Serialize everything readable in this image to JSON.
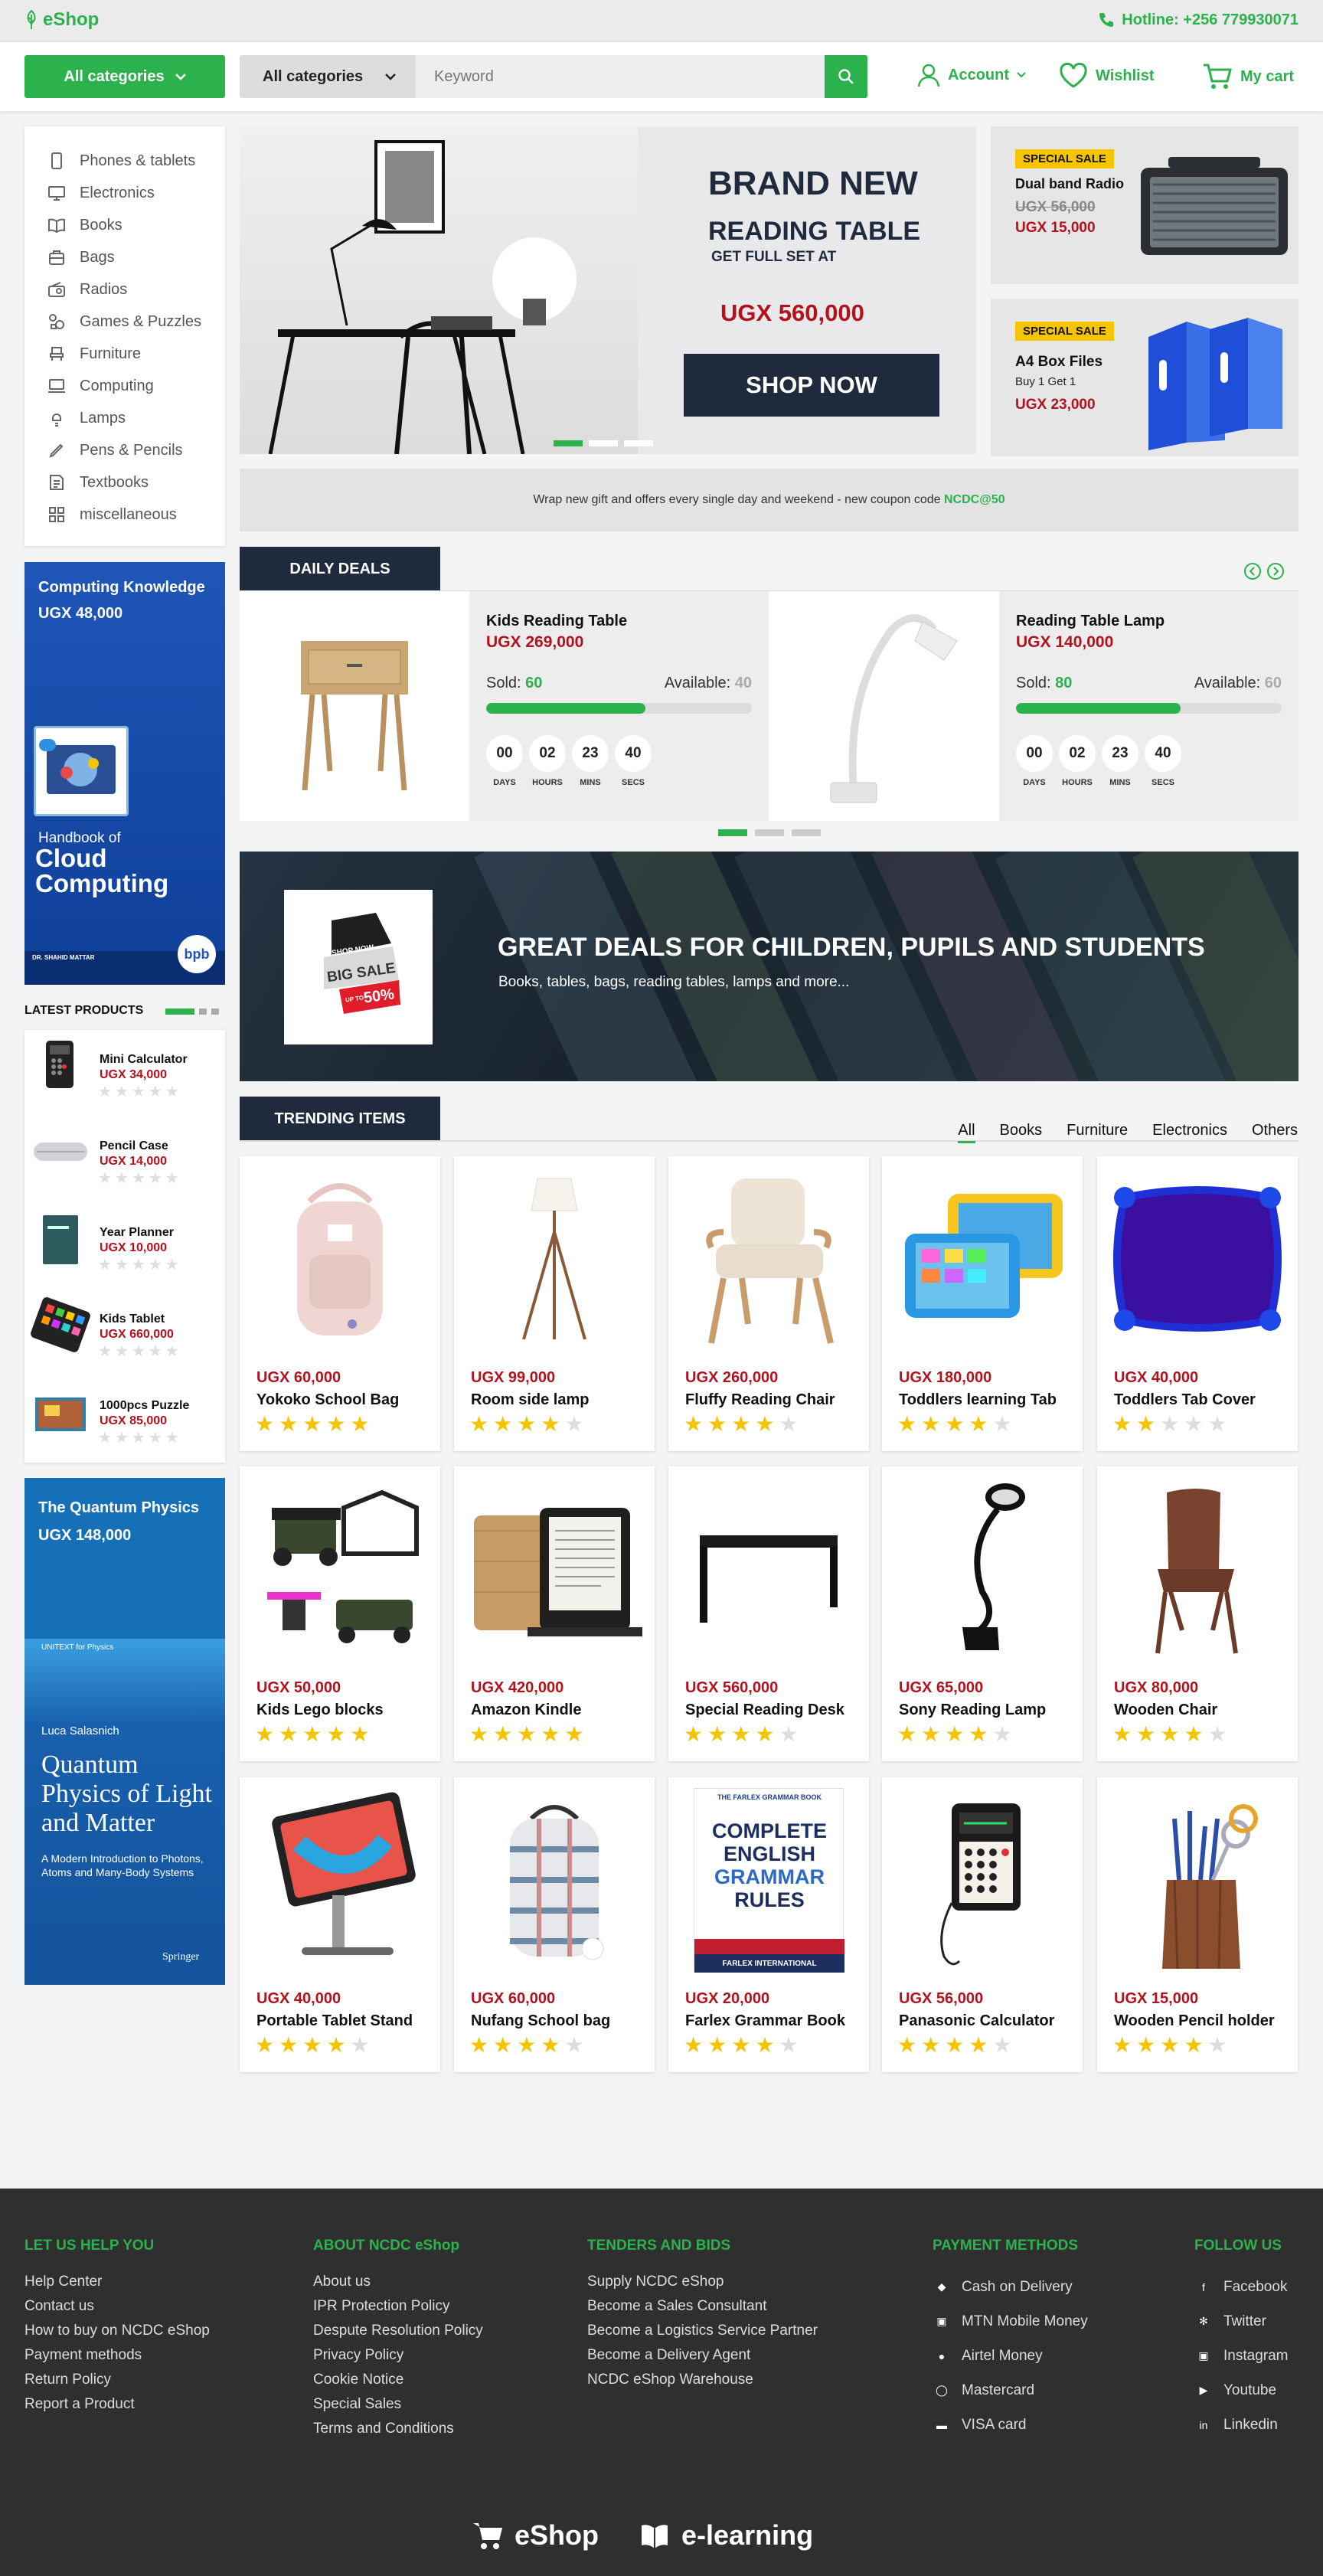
{
  "brand": {
    "logo": "eShop",
    "hotline": "Hotline: +256 779930071"
  },
  "header": {
    "all_categories": "All categories",
    "search_category": "All categories",
    "search_placeholder": "Keyword",
    "account": "Account",
    "wishlist": "Wishlist",
    "cart": "My cart"
  },
  "categories": [
    "Phones & tablets",
    "Electronics",
    "Books",
    "Bags",
    "Radios",
    "Games & Puzzles",
    "Furniture",
    "Computing",
    "Lamps",
    "Pens & Pencils",
    "Textbooks",
    "miscellaneous"
  ],
  "promo_left_1": {
    "title": "Computing Knowledge",
    "price": "UGX 48,000",
    "book_sub": "Handbook of",
    "book_title": "Cloud Computing",
    "book_author": "DR. SHAHID MATTAR",
    "book_badge": "bpb"
  },
  "hero": {
    "line1": "BRAND NEW",
    "line2": "READING TABLE",
    "line3": "GET FULL SET AT",
    "price": "UGX 560,000",
    "cta": "SHOP NOW"
  },
  "side_promos": [
    {
      "badge": "SPECIAL SALE",
      "name": "Dual band Radio",
      "old_price": "UGX 56,000",
      "price": "UGX 15,000"
    },
    {
      "badge": "SPECIAL SALE",
      "name": "A4 Box Files",
      "sub": "Buy 1 Get 1",
      "price": "UGX 23,000"
    }
  ],
  "coupon": {
    "text": "Wrap new gift and offers every single day and weekend - new coupon code ",
    "code": "NCDC@50"
  },
  "daily_deals": {
    "title": "DAILY DEALS",
    "items": [
      {
        "name": "Kids Reading Table",
        "price": "UGX 269,000",
        "sold_label": "Sold:",
        "sold": "60",
        "avail_label": "Available:",
        "available": "40",
        "progress": 0.6,
        "timer": [
          "00",
          "02",
          "23",
          "40"
        ]
      },
      {
        "name": "Reading Table Lamp",
        "price": "UGX 140,000",
        "sold_label": "Sold:",
        "sold": "80",
        "avail_label": "Available:",
        "available": "60",
        "progress": 0.62,
        "timer": [
          "00",
          "02",
          "23",
          "40"
        ]
      }
    ],
    "timer_labels": [
      "DAYS",
      "HOURS",
      "MINS",
      "SECS"
    ]
  },
  "banner": {
    "title": "GREAT DEALS FOR CHILDREN, PUPILS AND STUDENTS",
    "sub": "Books, tables, bags, reading tables, lamps and more...",
    "tag_top": "SHOP NOW",
    "tag_mid": "BIG SALE",
    "tag_off": "UP TO",
    "tag_pct": "50%"
  },
  "latest": {
    "title": "LATEST PRODUCTS",
    "items": [
      {
        "name": "Mini Calculator",
        "price": "UGX 34,000"
      },
      {
        "name": "Pencil Case",
        "price": "UGX 14,000"
      },
      {
        "name": "Year Planner",
        "price": "UGX 10,000"
      },
      {
        "name": "Kids Tablet",
        "price": "UGX 660,000"
      },
      {
        "name": "1000pcs Puzzle",
        "price": "UGX 85,000"
      }
    ]
  },
  "promo_left_2": {
    "title": "The Quantum Physics",
    "price": "UGX 148,000",
    "series": "UNITEXT for Physics",
    "author": "Luca Salasnich",
    "book_title": "Quantum Physics of Light and Matter",
    "book_sub": "A Modern Introduction to Photons, Atoms and Many-Body Systems",
    "publisher": "Springer"
  },
  "trending": {
    "title": "TRENDING ITEMS",
    "tabs": [
      "All",
      "Books",
      "Furniture",
      "Electronics",
      "Others"
    ],
    "items": [
      {
        "price": "UGX 60,000",
        "name": "Yokoko School Bag",
        "rating": 5
      },
      {
        "price": "UGX 99,000",
        "name": "Room side lamp",
        "rating": 4
      },
      {
        "price": "UGX 260,000",
        "name": "Fluffy Reading Chair",
        "rating": 4
      },
      {
        "price": "UGX 180,000",
        "name": "Toddlers learning Tab",
        "rating": 4
      },
      {
        "price": "UGX 40,000",
        "name": "Toddlers Tab Cover",
        "rating": 2
      },
      {
        "price": "UGX 50,000",
        "name": "Kids Lego blocks",
        "rating": 5
      },
      {
        "price": "UGX 420,000",
        "name": "Amazon Kindle",
        "rating": 5
      },
      {
        "price": "UGX 560,000",
        "name": "Special Reading Desk",
        "rating": 4
      },
      {
        "price": "UGX 65,000",
        "name": "Sony Reading Lamp",
        "rating": 4
      },
      {
        "price": "UGX 80,000",
        "name": "Wooden Chair",
        "rating": 4
      },
      {
        "price": "UGX 40,000",
        "name": "Portable Tablet Stand",
        "rating": 4
      },
      {
        "price": "UGX 60,000",
        "name": "Nufang School bag",
        "rating": 4
      },
      {
        "price": "UGX 20,000",
        "name": "Farlex Grammar Book",
        "rating": 4
      },
      {
        "price": "UGX 56,000",
        "name": "Panasonic Calculator",
        "rating": 4
      },
      {
        "price": "UGX 15,000",
        "name": "Wooden Pencil holder",
        "rating": 4
      }
    ]
  },
  "grammar_book": {
    "top": "THE FARLEX GRAMMAR BOOK",
    "t1": "COMPLETE",
    "t2": "ENGLISH",
    "t3": "GRAMMAR",
    "t4": "RULES",
    "foot": "FARLEX INTERNATIONAL"
  },
  "footer": {
    "help": {
      "title": "LET US HELP YOU",
      "links": [
        "Help Center",
        "Contact us",
        "How to buy on NCDC eShop",
        "Payment methods",
        "Return Policy",
        "Report a Product"
      ]
    },
    "about": {
      "title": "ABOUT NCDC eShop",
      "links": [
        "About us",
        "IPR Protection Policy",
        "Despute Resolution Policy",
        "Privacy Policy",
        "Cookie Notice",
        "Special Sales",
        "Terms and Conditions"
      ]
    },
    "tenders": {
      "title": "TENDERS AND BIDS",
      "links": [
        "Supply NCDC eShop",
        "Become a Sales Consultant",
        "Become a Logistics Service Partner",
        "Become a Delivery Agent",
        "NCDC eShop Warehouse"
      ]
    },
    "payment": {
      "title": "PAYMENT METHODS",
      "links": [
        "Cash on Delivery",
        "MTN Mobile Money",
        "Airtel Money",
        "Mastercard",
        "VISA card"
      ]
    },
    "follow": {
      "title": "FOLLOW US",
      "links": [
        "Facebook",
        "Twitter",
        "Instagram",
        "Youtube",
        "Linkedin"
      ]
    },
    "brands": [
      "eShop",
      "e-learning"
    ]
  }
}
